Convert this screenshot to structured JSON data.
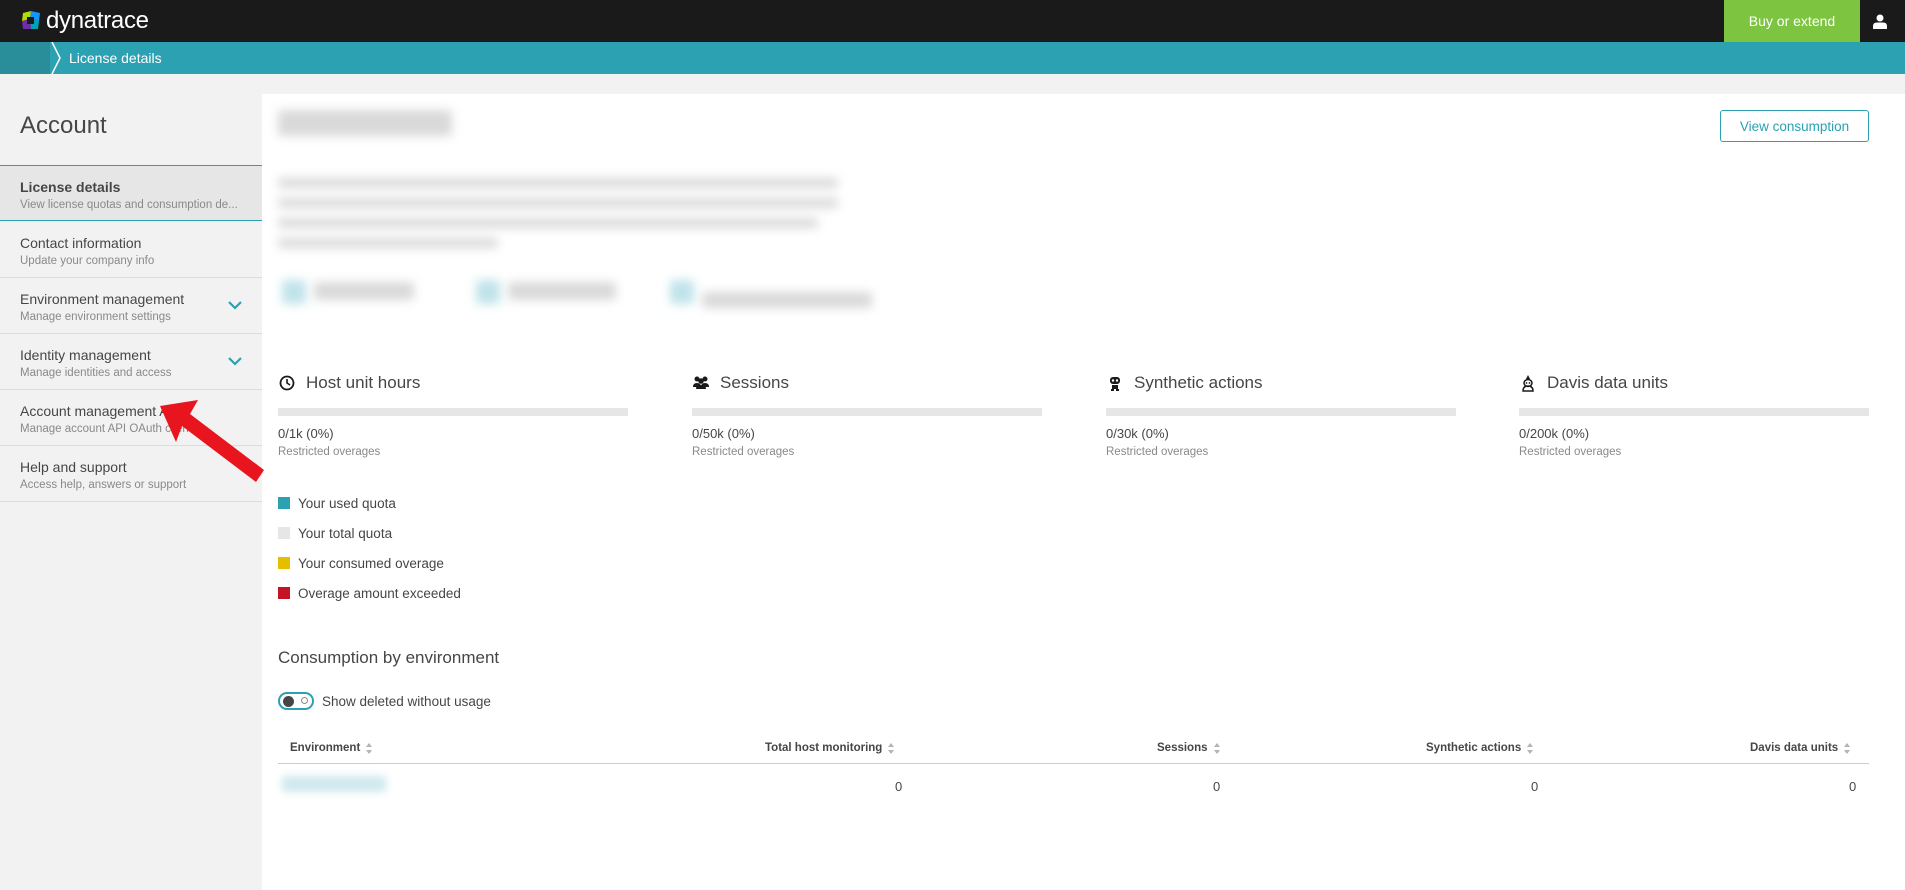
{
  "topbar": {
    "logo_text": "dynatrace",
    "buy_label": "Buy or extend",
    "user_icon": "user-icon"
  },
  "breadcrumb": {
    "current": "License details"
  },
  "sidebar": {
    "title": "Account",
    "items": [
      {
        "label": "License details",
        "sub": "View license quotas and consumption de...",
        "active": true
      },
      {
        "label": "Contact information",
        "sub": "Update your company info"
      },
      {
        "label": "Environment management",
        "sub": "Manage environment settings",
        "expandable": true
      },
      {
        "label": "Identity management",
        "sub": "Manage identities and access",
        "expandable": true
      },
      {
        "label": "Account management API",
        "sub": "Manage account API OAuth clients"
      },
      {
        "label": "Help and support",
        "sub": "Access help, answers or support"
      }
    ]
  },
  "main": {
    "view_consumption_label": "View consumption",
    "metrics": [
      {
        "title": "Host unit hours",
        "icon": "clock-icon",
        "value": "0/1k  (0%)",
        "note": "Restricted overages"
      },
      {
        "title": "Sessions",
        "icon": "users-icon",
        "value": "0/50k  (0%)",
        "note": "Restricted overages"
      },
      {
        "title": "Synthetic actions",
        "icon": "robot-icon",
        "value": "0/30k  (0%)",
        "note": "Restricted overages"
      },
      {
        "title": "Davis data units",
        "icon": "davis-icon",
        "value": "0/200k  (0%)",
        "note": "Restricted overages"
      }
    ],
    "legend": [
      {
        "label": "Your used quota",
        "color": "#2ba1b1"
      },
      {
        "label": "Your total quota",
        "color": "#e6e6e6"
      },
      {
        "label": "Your consumed overage",
        "color": "#e6be00"
      },
      {
        "label": "Overage amount exceeded",
        "color": "#c41425"
      }
    ],
    "consumption_title": "Consumption by environment",
    "toggle_label": "Show deleted without usage",
    "table": {
      "headers": [
        "Environment",
        "Total host monitoring",
        "Sessions",
        "Synthetic actions",
        "Davis data units"
      ],
      "rows": [
        {
          "environment": "",
          "host": "0",
          "sessions": "0",
          "synthetic": "0",
          "davis": "0"
        }
      ]
    }
  },
  "colors": {
    "accent": "#2ba1b1",
    "buy": "#7dc540",
    "topbar": "#1a1a1a",
    "annotation": "#e8141e"
  }
}
